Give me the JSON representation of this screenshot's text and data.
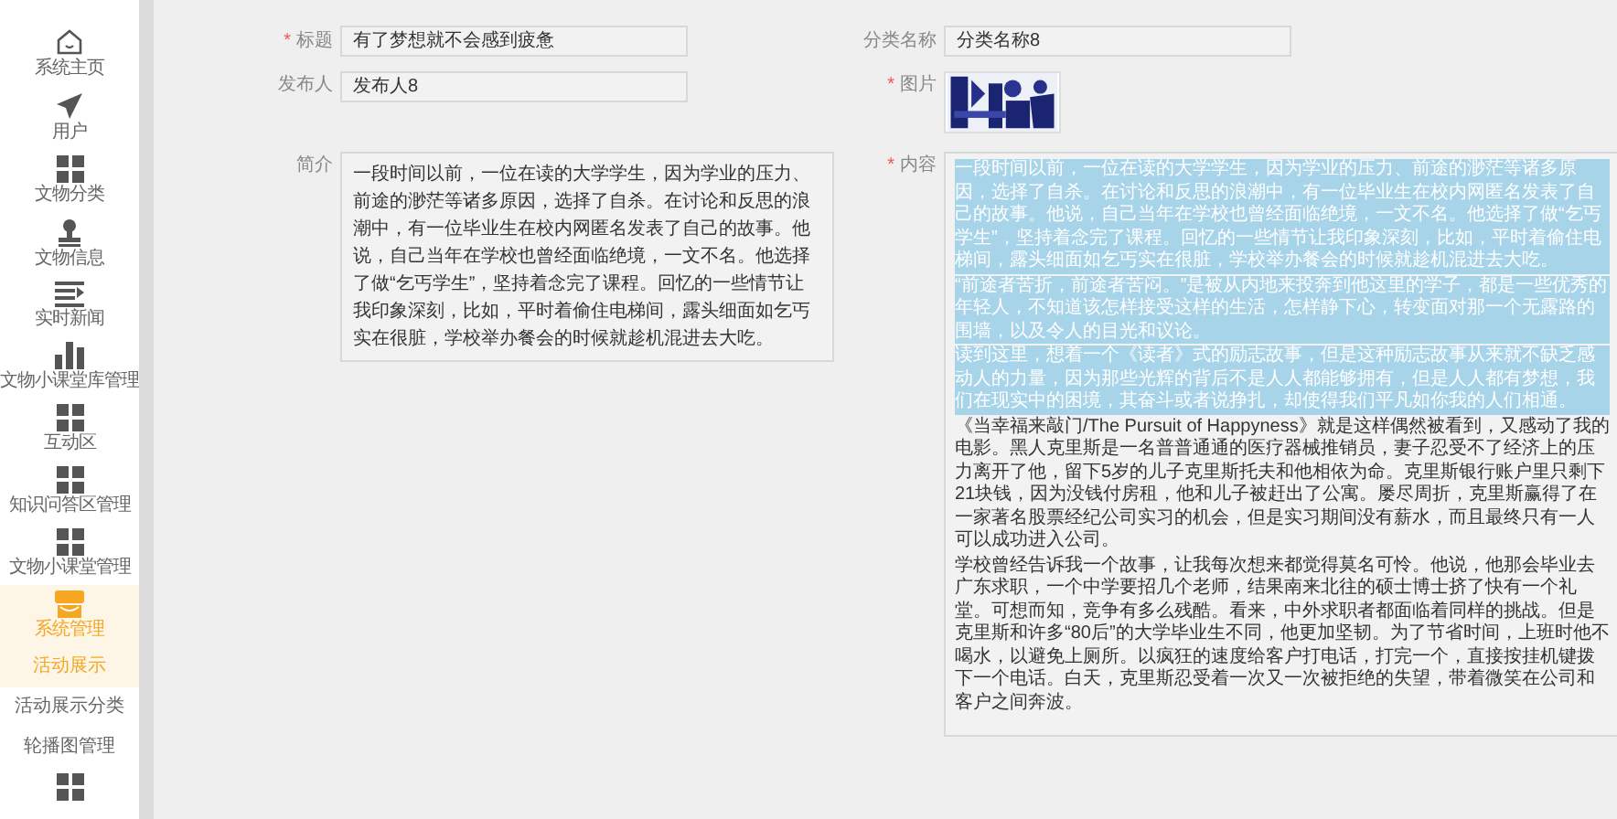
{
  "sidebar": {
    "items": [
      {
        "label": "系统主页",
        "kind": "home",
        "selected": false
      },
      {
        "label": "用户",
        "kind": "send",
        "selected": false
      },
      {
        "label": "文物分类",
        "kind": "grid",
        "selected": false
      },
      {
        "label": "文物信息",
        "kind": "stamp",
        "selected": false
      },
      {
        "label": "实时新闻",
        "kind": "list",
        "selected": false
      },
      {
        "label": "文物小课堂库管理",
        "kind": "bars",
        "selected": false
      },
      {
        "label": "互动区",
        "kind": "grid",
        "selected": false
      },
      {
        "label": "知识问答区管理",
        "kind": "grid",
        "selected": false
      },
      {
        "label": "文物小课堂管理",
        "kind": "grid",
        "selected": false
      },
      {
        "label": "系统管理",
        "kind": "shop",
        "selected": true,
        "expanded": true,
        "children": [
          {
            "label": "活动展示",
            "selected": true
          },
          {
            "label": "活动展示分类",
            "selected": false
          },
          {
            "label": "轮播图管理",
            "selected": false
          }
        ]
      },
      {
        "kind": "grid",
        "selected": false
      }
    ]
  },
  "form": {
    "title": {
      "mark": "*",
      "label": "标题",
      "value": "有了梦想就不会感到疲惫"
    },
    "category": {
      "label": "分类名称",
      "value": "分类名称8"
    },
    "publisher": {
      "label": "发布人",
      "value": "发布人8"
    },
    "image": {
      "mark": "*",
      "label": "图片",
      "kind": "picture"
    },
    "summary": {
      "label": "简介",
      "value": "一段时间以前，一位在读的大学学生，因为学业的压力、前途的渺茫等诸多原因，选择了自杀。在讨论和反思的浪潮中，有一位毕业生在校内网匿名发表了自己的故事。他说，自己当年在学校也曾经面临绝境，一文不名。他选择了做“乞丐学生”，坚持着念完了课程。回忆的一些情节让我印象深刻，比如，平时着偷住电梯间，露头细面如乞丐实在很脏，学校举办餐会的时候就趁机混进去大吃。"
    },
    "content": {
      "mark": "*",
      "label": "内容",
      "paragraphs": [
        {
          "text": "一段时间以前，一位在读的大学学生，因为学业的压力、前途的渺茫等诸多原因，选择了自杀。在讨论和反思的浪潮中，有一位毕业生在校内网匿名发表了自己的故事。他说，自己当年在学校也曾经面临绝境，一文不名。他选择了做“乞丐学生”，坚持着念完了课程。回忆的一些情节让我印象深刻，比如，平时着偷住电梯间，露头细面如乞丐实在很脏，学校举办餐会的时候就趁机混进去大吃。",
          "selected": true
        },
        {
          "text": "“前途者苦折，前途者苦闷。”是被从内地来投奔到他这里的学子，都是一些优秀的年轻人，不知道该怎样接受这样的生活，怎样静下心，转变面对那一个无露路的围墙，以及令人的目光和议论。",
          "selected": true
        },
        {
          "text": "读到这里，想着一个《读者》式的励志故事，但是这种励志故事从来就不缺乏感动人的力量，因为那些光辉的背后不是人人都能够拥有，但是人人都有梦想，我们在现实中的困境，其奋斗或者说挣扎，却使得我们平凡如你我的人们相通。",
          "selected": true
        },
        {
          "text": "《当幸福来敲门/The Pursuit of Happyness》就是这样偶然被看到，又感动了我的电影。黑人克里斯是一名普普通通的医疗器械推销员，妻子忍受不了经济上的压力离开了他，留下5岁的儿子克里斯托夫和他相依为命。克里斯银行账户里只剩下21块钱，因为没钱付房租，他和儿子被赶出了公寓。屡尽周折，克里斯赢得了在一家著名股票经纪公司实习的机会，但是实习期间没有薪水，而且最终只有一人可以成功进入公司。",
          "selected": false
        },
        {
          "text": "学校曾经告诉我一个故事，让我每次想来都觉得莫名可怜。他说，他那会毕业去广东求职，一个中学要招几个老师，结果南来北往的硕士博士挤了快有一个礼堂。可想而知，竞争有多么残酷。看来，中外求职者都面临着同样的挑战。但是克里斯和许多“80后”的大学毕业生不同，他更加坚韧。为了节省时间，上班时他不喝水，以避免上厕所。以疯狂的速度给客户打电话，打完一个，直接按挂机键拨下一个电话。白天，克里斯忍受着一次又一次被拒绝的失望，带着微笑在公司和客户之间奔波。",
          "selected": false
        }
      ]
    }
  }
}
